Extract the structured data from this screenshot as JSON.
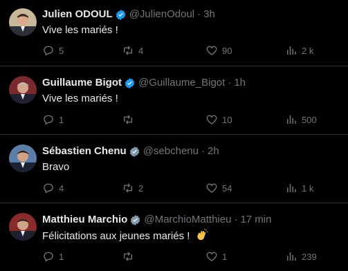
{
  "colors": {
    "background": "#000000",
    "text": "#e7e9ea",
    "muted": "#71767b",
    "divider": "#2f3336",
    "verified_blue": "#1d9bf0",
    "verified_gray": "#829aab"
  },
  "tweets": [
    {
      "name": "Julien ODOUL",
      "handle": "@JulienOdoul",
      "time": "3h",
      "badge": "verified-blue",
      "text": "Vive les mariés !",
      "replies": "5",
      "retweets": "4",
      "likes": "90",
      "views": "2 k"
    },
    {
      "name": "Guillaume Bigot",
      "handle": "@Guillaume_Bigot",
      "time": "1h",
      "badge": "verified-blue",
      "text": "Vive les mariés !",
      "replies": "1",
      "retweets": "",
      "likes": "10",
      "views": "500"
    },
    {
      "name": "Sébastien Chenu",
      "handle": "@sebchenu",
      "time": "2h",
      "badge": "verified-gray",
      "text": "Bravo",
      "replies": "4",
      "retweets": "2",
      "likes": "54",
      "views": "1 k"
    },
    {
      "name": "Matthieu Marchio",
      "handle": "@MarchioMatthieu",
      "time": "17 min",
      "badge": "verified-gray",
      "text": "Félicitations aux jeunes mariés !",
      "emoji": "clapping-hands",
      "replies": "1",
      "retweets": "",
      "likes": "1",
      "views": "239"
    }
  ],
  "separator": "·"
}
